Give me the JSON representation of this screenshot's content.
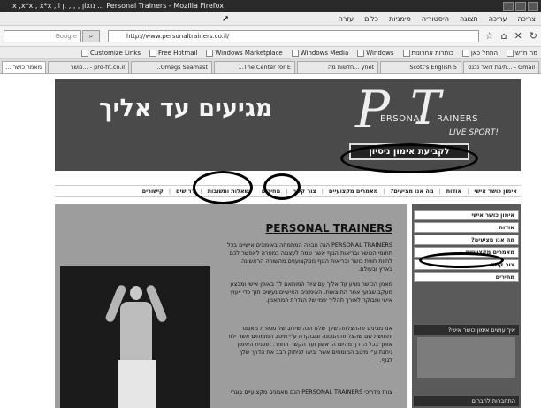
{
  "window": {
    "title": "Personal Trainers - Mozilla Firefox",
    "title_prefix": "x  ,x*x , x*x ,ll ן  ,  ,   , ,ןlxנו ..."
  },
  "menu": [
    "צריכה",
    "עריכה",
    "תצוגה",
    "היסטוריה",
    "סימניות",
    "כלים",
    "עזרה"
  ],
  "navbar": {
    "search_placeholder": "Google",
    "url": "http://www.personaltrainers.co.il/"
  },
  "bookmarks": [
    "מה חדש",
    "התחל כאן",
    "כותרות אחרונות",
    "Windows",
    "Windows Media",
    "Windows Marketplace",
    "Free Hotmail",
    "Customize Links"
  ],
  "tabs": [
    "Gmail - ...תיבת דואר נכנס",
    "Scott's English 5",
    "ynet ...חדשות מה",
    "The Center for E...",
    "Omegs Seamast...",
    "pro-fit.co.il - ...כושר",
    "מאמר כושר ..."
  ],
  "site": {
    "slogan": "מגיעים עד אליך",
    "logo_p": "P",
    "logo_t": "T",
    "logo_word1": "ERSONAL",
    "logo_word2": "RAINERS",
    "logo_live": "LIVE SPORT!",
    "trial_button": "לקביעת אימון ניסיון",
    "topnav": [
      "אימון כושר אישי",
      "אודות",
      "מה אנו מציעים?",
      "מאמרים מקצועיים",
      "צור קשר",
      "מחירים",
      "שאלות ותשובות",
      "דרושים",
      "קישורים"
    ],
    "content_title": "PERSONAL TRAINERS",
    "paragraphs": [
      "PERSONAL TRAINERS הנה חברה המתמחה באימונים אישיים בכל תחומי הכושר ובריאות הגוף אשר שמה לעצמה כמטרה לאפשר לכם לחוות חווית כושר ובריאות הגוף ממקצוענים מהשורה הראשונה בארץ ובעולם.",
      "מאמן הכושר מגיע עד אליך עם ציוד המותאם לך באופן אישי ומבצע מעקב שבועי אחר התוצאות. האימונים האישיים נעשים תוך כדי ייעוץ אישי ומבוקר לאורך תהליך שמי של הגדרת המתאמן.",
      "אנו מבינים שההצלחה שלך שלנו הנה שילוב של מסורת מאמנר ותחושת שם שהצלחת הנכונה ומבוקרת ע\"י מיטב המומחים אשר ילוו אותך בכל הדרך מהיום הראשון ועד הקשר החוזר. תוכנית האימון ניתנת ע\"י מיטב המומחים אשר יביאו לניתוק רבב את הדרך שלך לגוף.",
      "צוות מדריכי PERSONAL TRAINERS הנם מאמנים מקצועיים בוגרי"
    ],
    "sidebar": [
      "אימון כושר אישי",
      "אודות",
      "מה אנו מציעים?",
      "מאמרים מקצועיים",
      "צור קשר",
      "מחירים"
    ],
    "sidebar_box_title": "איך עושים אימון כושר אישי?",
    "sidebar_footer": "התחברות לחברים"
  }
}
